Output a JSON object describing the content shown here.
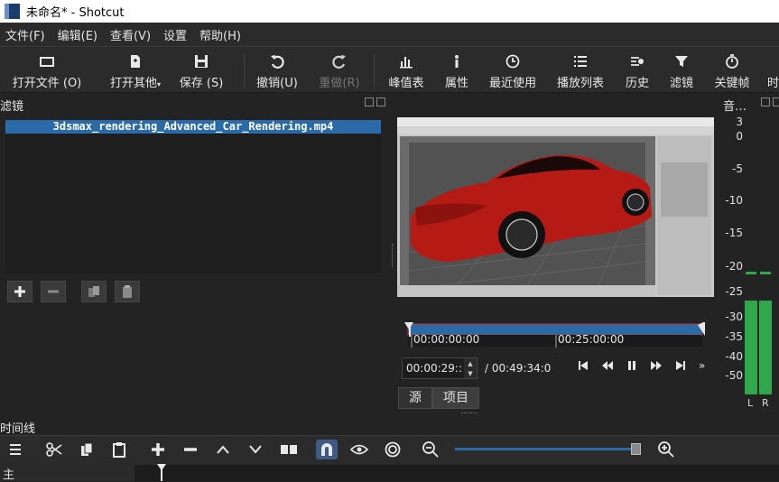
{
  "window": {
    "title": "未命名* - Shotcut"
  },
  "menu": [
    "文件(F)",
    "编辑(E)",
    "查看(V)",
    "设置",
    "帮助(H)"
  ],
  "toolbar": {
    "open_file": "打开文件 (O)",
    "open_other": "打开其他",
    "save": "保存 (S)",
    "undo": "撤销(U)",
    "redo": "重做(R)",
    "peak_meter": "峰值表",
    "properties": "属性",
    "recent": "最近使用",
    "playlist": "播放列表",
    "history": "历史",
    "filters": "滤镜",
    "keyframes": "关键帧",
    "timeline_partial": "时"
  },
  "filters_panel": {
    "title": "滤镜",
    "selected_clip": "3dsmax_rendering_Advanced_Car_Rendering.mp4"
  },
  "audio_panel": {
    "title": "音…",
    "scale": [
      "3",
      "0",
      "-5",
      "-10",
      "-15",
      "-20",
      "-25",
      "-30",
      "-35",
      "-40",
      "-50"
    ],
    "channels": [
      "L",
      "R"
    ]
  },
  "player": {
    "ruler_start": "00:00:00:00",
    "ruler_mid": "00:25:00:00",
    "current_timecode": "00:00:29::",
    "duration": "/ 00:49:34:0",
    "tabs": [
      "源",
      "项目"
    ]
  },
  "timeline": {
    "title": "时间线",
    "track_name": "主"
  },
  "colors": {
    "accent": "#2a6aa8",
    "meter": "#2ea84a",
    "car": "#b51a14"
  }
}
